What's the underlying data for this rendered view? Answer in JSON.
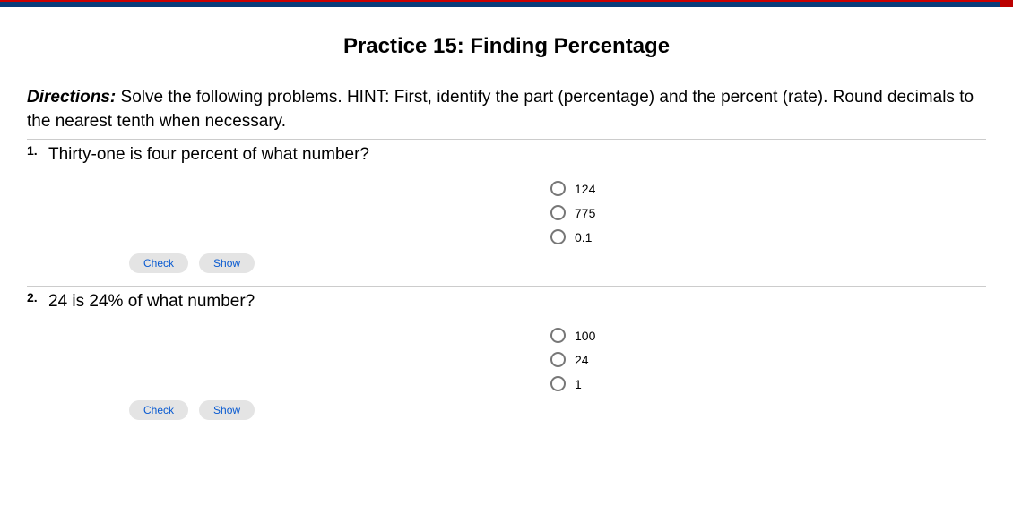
{
  "title": "Practice 15: Finding Percentage",
  "directions_label": "Directions:",
  "directions_text": " Solve the following problems. HINT: First, identify the part (percentage) and the percent (rate). Round decimals to the nearest tenth when necessary.",
  "buttons": {
    "check": "Check",
    "show": "Show"
  },
  "problems": [
    {
      "number": "1.",
      "question": "Thirty-one is four percent of what number?",
      "options": [
        "124",
        "775",
        "0.1"
      ]
    },
    {
      "number": "2.",
      "question": "24 is 24% of what number?",
      "options": [
        "100",
        "24",
        "1"
      ]
    }
  ]
}
